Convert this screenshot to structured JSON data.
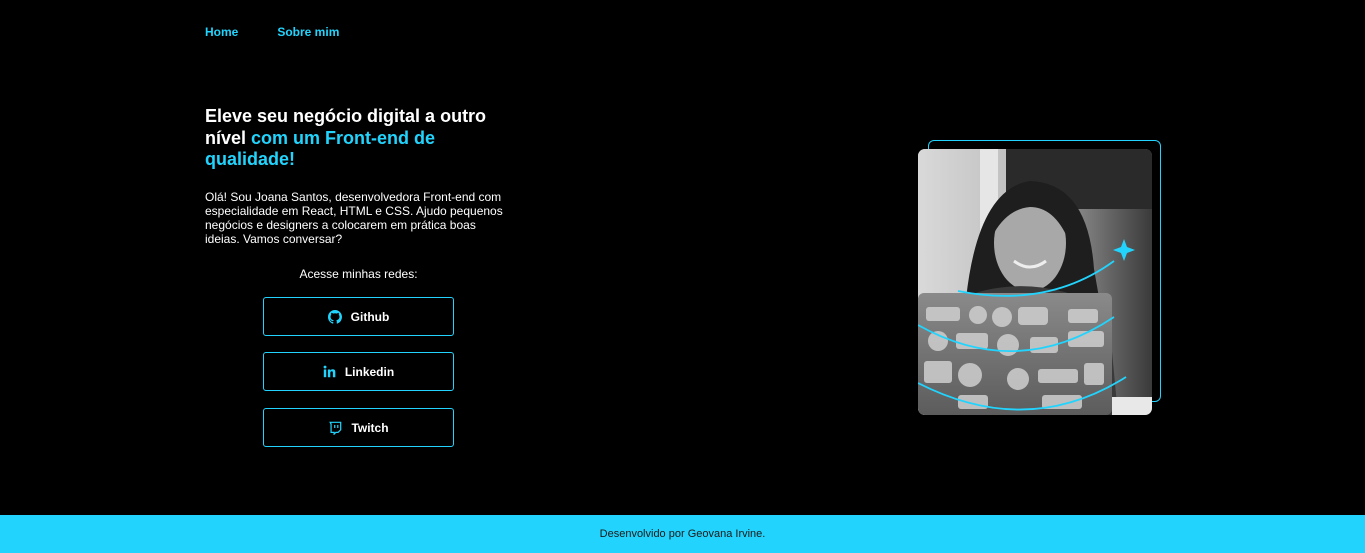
{
  "nav": {
    "items": [
      {
        "label": "Home"
      },
      {
        "label": "Sobre mim"
      }
    ]
  },
  "hero": {
    "title_part1": "Eleve seu negócio digital a outro nível ",
    "title_accent": "com um Front-end de qualidade!",
    "description": "Olá! Sou Joana Santos, desenvolvedora Front-end com especialidade em React, HTML e CSS. Ajudo pequenos negócios e designers a colocarem em prática boas ideias. Vamos conversar?"
  },
  "social": {
    "title": "Acesse minhas redes:",
    "buttons": [
      {
        "label": "Github",
        "icon": "github-icon"
      },
      {
        "label": "Linkedin",
        "icon": "linkedin-icon"
      },
      {
        "label": "Twitch",
        "icon": "twitch-icon"
      }
    ]
  },
  "footer": {
    "text": "Desenvolvido por Geovana Irvine."
  },
  "colors": {
    "accent": "#22d4fd",
    "background": "#000000",
    "text": "#ffffff"
  }
}
